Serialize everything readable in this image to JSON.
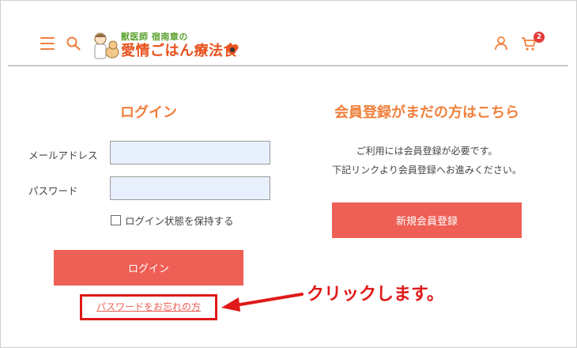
{
  "header": {
    "logo": {
      "line1": "獣医師 宿南章の",
      "line2": "愛情ごはん療法食"
    },
    "icons": [
      "hamburger-menu-icon",
      "search-icon",
      "user-icon",
      "cart-icon"
    ],
    "cart_count": "2"
  },
  "login": {
    "title": "ログイン",
    "email_label": "メールアドレス",
    "email_value": "",
    "password_label": "パスワード",
    "password_value": "",
    "remember_label": "ログイン状態を保持する",
    "remember_checked": false,
    "submit_label": "ログイン",
    "forgot_link": "パスワードをお忘れの方"
  },
  "register": {
    "title": "会員登録がまだの方はこちら",
    "desc_line1": "ご利用には会員登録が必要です。",
    "desc_line2": "下記リンクより会員登録へお進みください。",
    "button_label": "新規会員登録"
  },
  "annotation": {
    "text": "クリックします。"
  },
  "colors": {
    "accent_orange": "#f0803c",
    "button_red": "#ee5f55",
    "annotation_red": "#e01919",
    "input_bg": "#e8f0fe",
    "logo_green": "#5aa02c"
  }
}
